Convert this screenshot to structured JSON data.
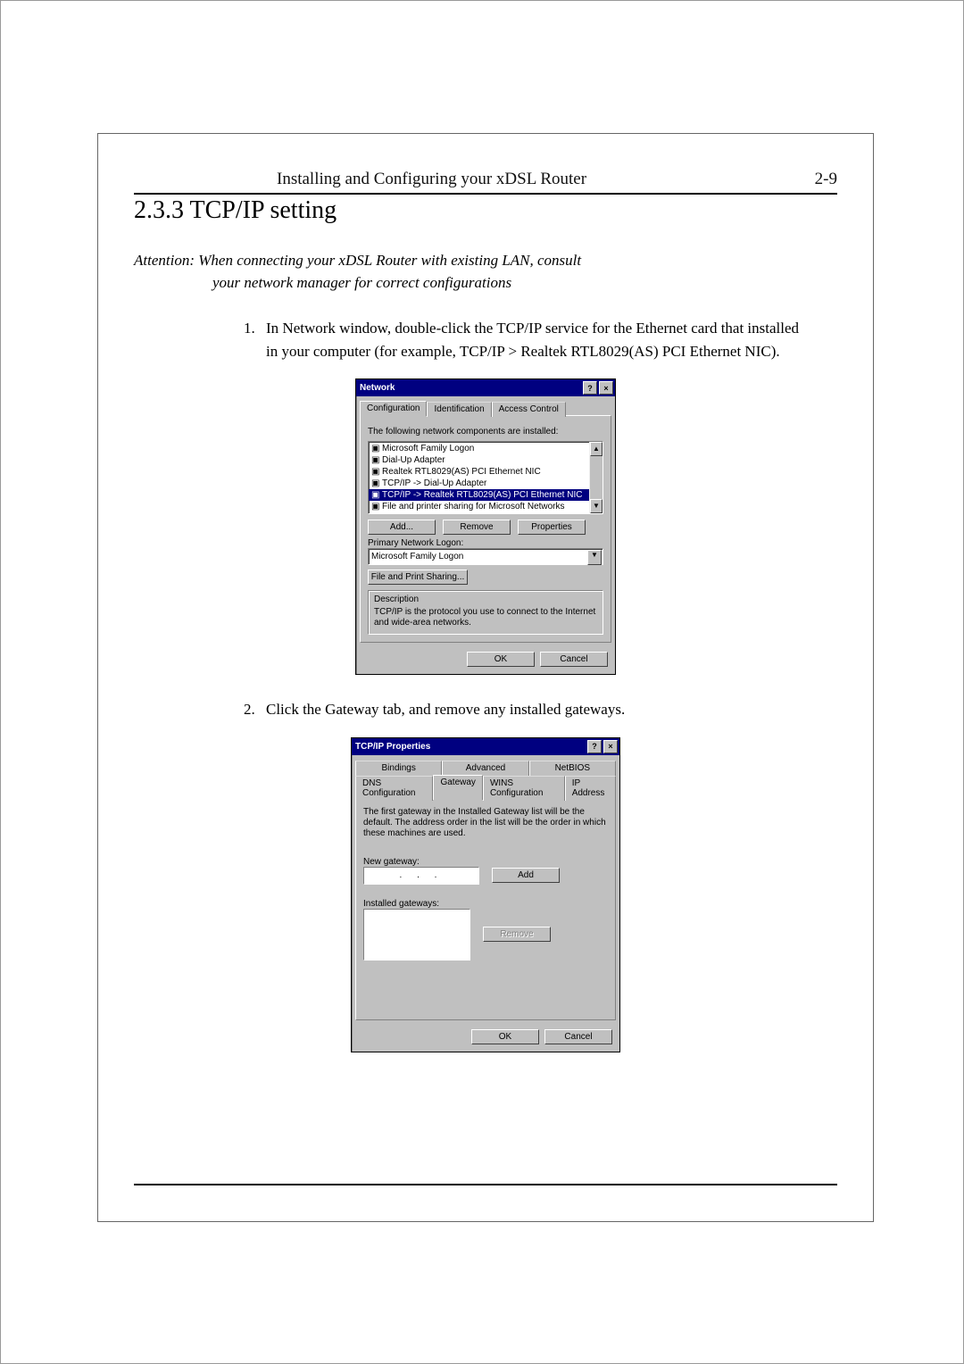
{
  "header": {
    "doc_title": "Installing and Configuring your xDSL Router",
    "page_ref": "2-9"
  },
  "section": {
    "number_title": "2.3.3 TCP/IP setting"
  },
  "attention": {
    "line1": "Attention: When connecting your xDSL Router with existing LAN, consult",
    "line2": "your network manager for correct configurations"
  },
  "steps": {
    "s1": "In Network window, double-click the TCP/IP service for the Ethernet card that installed in your computer (for example, TCP/IP > Realtek RTL8029(AS) PCI Ethernet NIC).",
    "s2": "Click the Gateway tab, and remove any installed gateways."
  },
  "dlg1": {
    "title": "Network",
    "tabs": {
      "t0": "Configuration",
      "t1": "Identification",
      "t2": "Access Control"
    },
    "intro": "The following network components are installed:",
    "items": {
      "i0": "Microsoft Family Logon",
      "i1": "Dial-Up Adapter",
      "i2": "Realtek RTL8029(AS) PCI Ethernet NIC",
      "i3": "TCP/IP -> Dial-Up Adapter",
      "i4": "TCP/IP -> Realtek RTL8029(AS) PCI Ethernet NIC",
      "i5": "File and printer sharing for Microsoft Networks"
    },
    "buttons": {
      "add": "Add...",
      "remove": "Remove",
      "props": "Properties"
    },
    "primary_label": "Primary Network Logon:",
    "primary_value": "Microsoft Family Logon",
    "fps": "File and Print Sharing...",
    "desc_title": "Description",
    "desc_text": "TCP/IP is the protocol you use to connect to the Internet and wide-area networks.",
    "ok": "OK",
    "cancel": "Cancel"
  },
  "dlg2": {
    "title": "TCP/IP Properties",
    "tabs": {
      "r1a": "Bindings",
      "r1b": "Advanced",
      "r1c": "NetBIOS",
      "r2a": "DNS Configuration",
      "r2b": "Gateway",
      "r2c": "WINS Configuration",
      "r2d": "IP Address"
    },
    "intro": "The first gateway in the Installed Gateway list will be the default. The address order in the list will be the order in which these machines are used.",
    "new_gw_label": "New gateway:",
    "ip_dots": ".   .   .",
    "add": "Add",
    "inst_gw_label": "Installed gateways:",
    "remove": "Remove",
    "ok": "OK",
    "cancel": "Cancel"
  }
}
